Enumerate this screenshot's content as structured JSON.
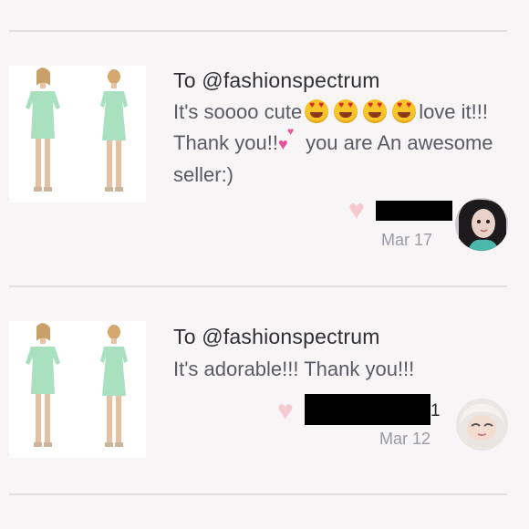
{
  "reviews": [
    {
      "title": "To @fashionspectrum",
      "text_part1": "It's soooo cute",
      "emoji_names": [
        "heart-eyes-emoji",
        "heart-eyes-emoji",
        "heart-eyes-emoji",
        "heart-eyes-emoji"
      ],
      "text_part2": "love it!!! Thank you!!",
      "text_part3": " you are An awesome seller:)",
      "like_icon": "heart-icon",
      "date": "Mar 17"
    },
    {
      "title": "To @fashionspectrum",
      "text_part1": "It's adorable!!! Thank you!!!",
      "like_icon": "heart-icon",
      "username_visible": "1",
      "date": "Mar 12"
    }
  ],
  "colors": {
    "background": "#f7f5f6",
    "divider": "#e1dfe2",
    "title": "#2f2f33",
    "body_text": "#5a5a62",
    "date": "#9a9aa2",
    "like_heart": "#f6c8cf",
    "dress": "#a8e0c0"
  }
}
